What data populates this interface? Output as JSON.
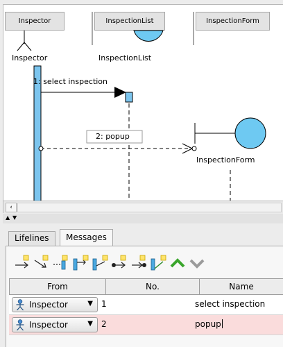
{
  "diagram": {
    "columns": [
      "Inspector",
      "InspectionList",
      "InspectionForm"
    ],
    "lifelines": [
      "Inspector",
      "InspectionList",
      "InspectionForm"
    ],
    "messages": [
      {
        "label": "1: select inspection"
      },
      {
        "label": "2: popup"
      }
    ],
    "colors": {
      "activation": "#7cc5ee",
      "object": "#6ec9f2"
    }
  },
  "tabs": [
    {
      "label": "Lifelines"
    },
    {
      "label": "Messages",
      "selected": true
    }
  ],
  "toolbar": {
    "icons": [
      "add-message-icon",
      "add-self-message-icon",
      "add-create-message-icon",
      "add-return-message-icon",
      "add-reply-message-icon",
      "add-lost-message-icon",
      "add-found-message-icon",
      "add-duration-message-icon",
      "move-up-icon",
      "move-down-icon"
    ]
  },
  "table": {
    "headers": {
      "from": "From",
      "no": "No.",
      "name": "Name"
    },
    "rows": [
      {
        "from": "Inspector",
        "no": "1",
        "name": "select inspection"
      },
      {
        "from": "Inspector",
        "no": "2",
        "name": "popup"
      }
    ]
  }
}
